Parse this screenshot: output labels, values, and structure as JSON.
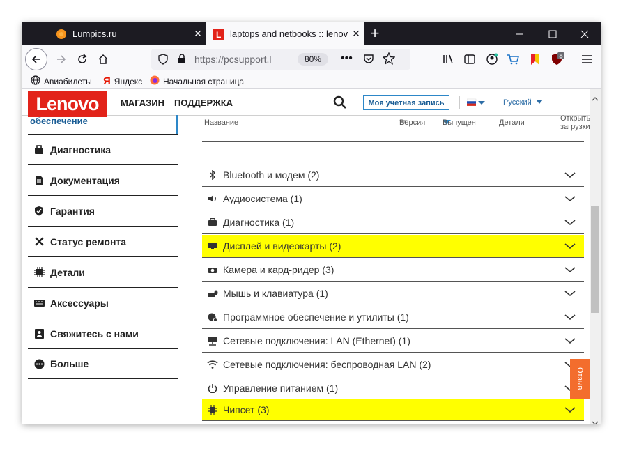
{
  "tabs": [
    {
      "title": "Lumpics.ru",
      "close": "✕"
    },
    {
      "title": "laptops and netbooks :: lenovo",
      "close": "✕"
    }
  ],
  "new_tab": "+",
  "window_controls": {
    "minimize": "—",
    "maximize": "☐",
    "close": "✕"
  },
  "url": "https://pcsupport.lenovo.com",
  "zoom": "80%",
  "extension_badge": "8",
  "bookmarks": [
    "Авиабилеты",
    "Яндекс",
    "Начальная страница"
  ],
  "header": {
    "logo": "Lenovo",
    "nav": [
      "МАГАЗИН",
      "ПОДДЕРЖКА"
    ],
    "account_button": "Моя учетная запись",
    "language": "Русский"
  },
  "sidebar": {
    "current_partial": "обеспечение",
    "items": [
      {
        "label": "Диагностика",
        "icon": "toolbox-icon"
      },
      {
        "label": "Документация",
        "icon": "document-icon"
      },
      {
        "label": "Гарантия",
        "icon": "shield-icon"
      },
      {
        "label": "Статус ремонта",
        "icon": "tools-icon"
      },
      {
        "label": "Детали",
        "icon": "chip-icon"
      },
      {
        "label": "Аксессуары",
        "icon": "keyboard-icon"
      },
      {
        "label": "Свяжитесь с нами",
        "icon": "contact-icon"
      },
      {
        "label": "Больше",
        "icon": "more-icon"
      }
    ]
  },
  "table": {
    "headers": {
      "name": "Название",
      "version": "Версия",
      "released": "Выпущен",
      "details": "Детали",
      "open_downloads_1": "Открытые",
      "open_downloads_2": "загрузки"
    },
    "rows": [
      {
        "label": "Bluetooth и модем (2)",
        "icon": "bluetooth-icon",
        "highlighted": false
      },
      {
        "label": "Аудиосистема (1)",
        "icon": "speaker-icon",
        "highlighted": false
      },
      {
        "label": "Диагностика (1)",
        "icon": "toolbox-icon",
        "highlighted": false
      },
      {
        "label": "Дисплей и видеокарты (2)",
        "icon": "monitor-icon",
        "highlighted": true
      },
      {
        "label": "Камера и кард-ридер (3)",
        "icon": "camera-icon",
        "highlighted": false
      },
      {
        "label": "Мышь и клавиатура (1)",
        "icon": "mouse-keyboard-icon",
        "highlighted": false
      },
      {
        "label": "Программное обеспечение и утилиты (1)",
        "icon": "software-icon",
        "highlighted": false
      },
      {
        "label": "Сетевые подключения: LAN (Ethernet) (1)",
        "icon": "lan-icon",
        "highlighted": false
      },
      {
        "label": "Сетевые подключения: беспроводная LAN (2)",
        "icon": "wifi-icon",
        "highlighted": false
      },
      {
        "label": "Управление питанием (1)",
        "icon": "power-icon",
        "highlighted": false
      },
      {
        "label": "Чипсет (3)",
        "icon": "chipset-icon",
        "highlighted": true
      }
    ]
  },
  "feedback": "Отзыв",
  "colors": {
    "highlight": "#ffff00",
    "lenovo_red": "#e2231a",
    "link_blue": "#1a5d95"
  }
}
